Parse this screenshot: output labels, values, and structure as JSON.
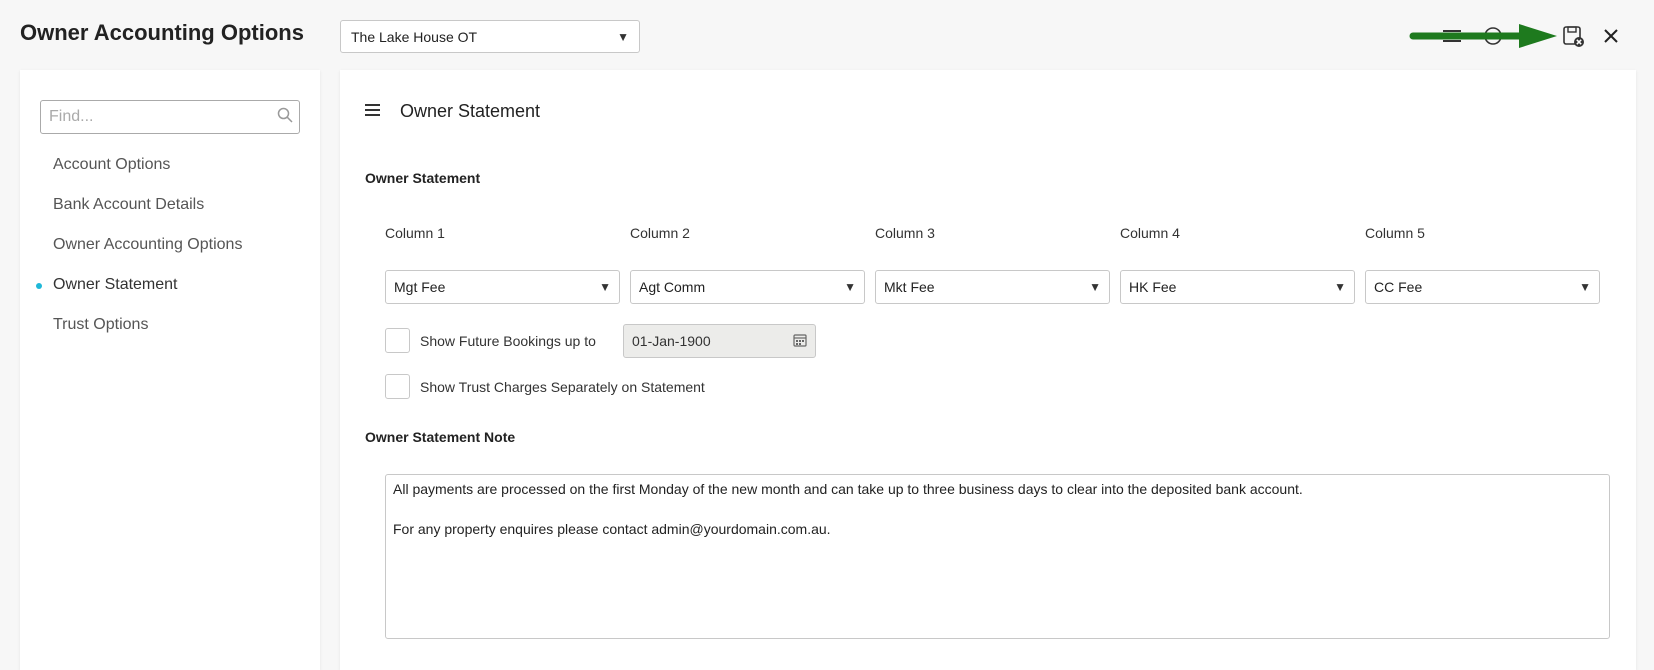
{
  "header": {
    "title": "Owner Accounting Options",
    "property_selected": "The Lake House OT"
  },
  "toolbar": {
    "icons": [
      "list-icon",
      "help-icon",
      "save-close-icon",
      "close-icon"
    ],
    "arrow_color": "#1e7a1e"
  },
  "sidebar": {
    "search_placeholder": "Find...",
    "items": [
      {
        "label": "Account Options",
        "active": false
      },
      {
        "label": "Bank Account Details",
        "active": false
      },
      {
        "label": "Owner Accounting Options",
        "active": false
      },
      {
        "label": "Owner Statement",
        "active": true
      },
      {
        "label": "Trust Options",
        "active": false
      }
    ],
    "active_dot_color": "#1fb8d8"
  },
  "main": {
    "title": "Owner Statement",
    "section_label": "Owner Statement",
    "columns": [
      {
        "label": "Column 1",
        "value": "Mgt Fee"
      },
      {
        "label": "Column 2",
        "value": "Agt Comm"
      },
      {
        "label": "Column 3",
        "value": "Mkt Fee"
      },
      {
        "label": "Column 4",
        "value": "HK Fee"
      },
      {
        "label": "Column 5",
        "value": "CC Fee"
      }
    ],
    "future_bookings_label": "Show Future Bookings up to",
    "future_bookings_date": "01-Jan-1900",
    "trust_charges_label": "Show Trust Charges Separately on Statement",
    "note_section_label": "Owner Statement Note",
    "note_lines": [
      "All payments are processed on the first Monday of the new month and can take up to three business days to clear into the deposited bank account.",
      "",
      "For any property enquires please contact admin@yourdomain.com.au."
    ]
  }
}
